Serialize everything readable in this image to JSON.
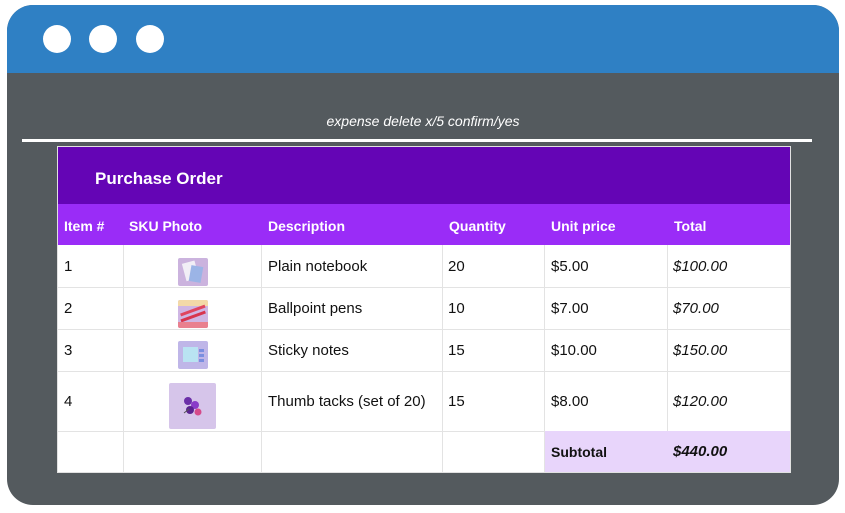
{
  "command_text": "expense delete x/5 confirm/yes",
  "purchase_order": {
    "title": "Purchase Order",
    "columns": [
      "Item #",
      "SKU Photo",
      "Description",
      "Quantity",
      "Unit price",
      "Total"
    ],
    "rows": [
      {
        "item": "1",
        "photo_icon": "notebook-photo-icon",
        "description": "Plain notebook",
        "quantity": "20",
        "unit_price": "$5.00",
        "total": "$100.00"
      },
      {
        "item": "2",
        "photo_icon": "pens-photo-icon",
        "description": "Ballpoint pens",
        "quantity": "10",
        "unit_price": "$7.00",
        "total": "$70.00"
      },
      {
        "item": "3",
        "photo_icon": "sticky-notes-photo-icon",
        "description": "Sticky notes",
        "quantity": "15",
        "unit_price": "$10.00",
        "total": "$150.00"
      },
      {
        "item": "4",
        "photo_icon": "thumb-tacks-photo-icon",
        "description": "Thumb tacks (set of 20)",
        "quantity": "15",
        "unit_price": "$8.00",
        "total": "$120.00"
      }
    ],
    "subtotal_label": "Subtotal",
    "subtotal_value": "$440.00"
  },
  "colors": {
    "titlebar": "#2f80c4",
    "window_body": "#545a5e",
    "po_header": "#6405b5",
    "table_header": "#9a2cf7",
    "subtotal_bg": "#e8d5fb"
  }
}
